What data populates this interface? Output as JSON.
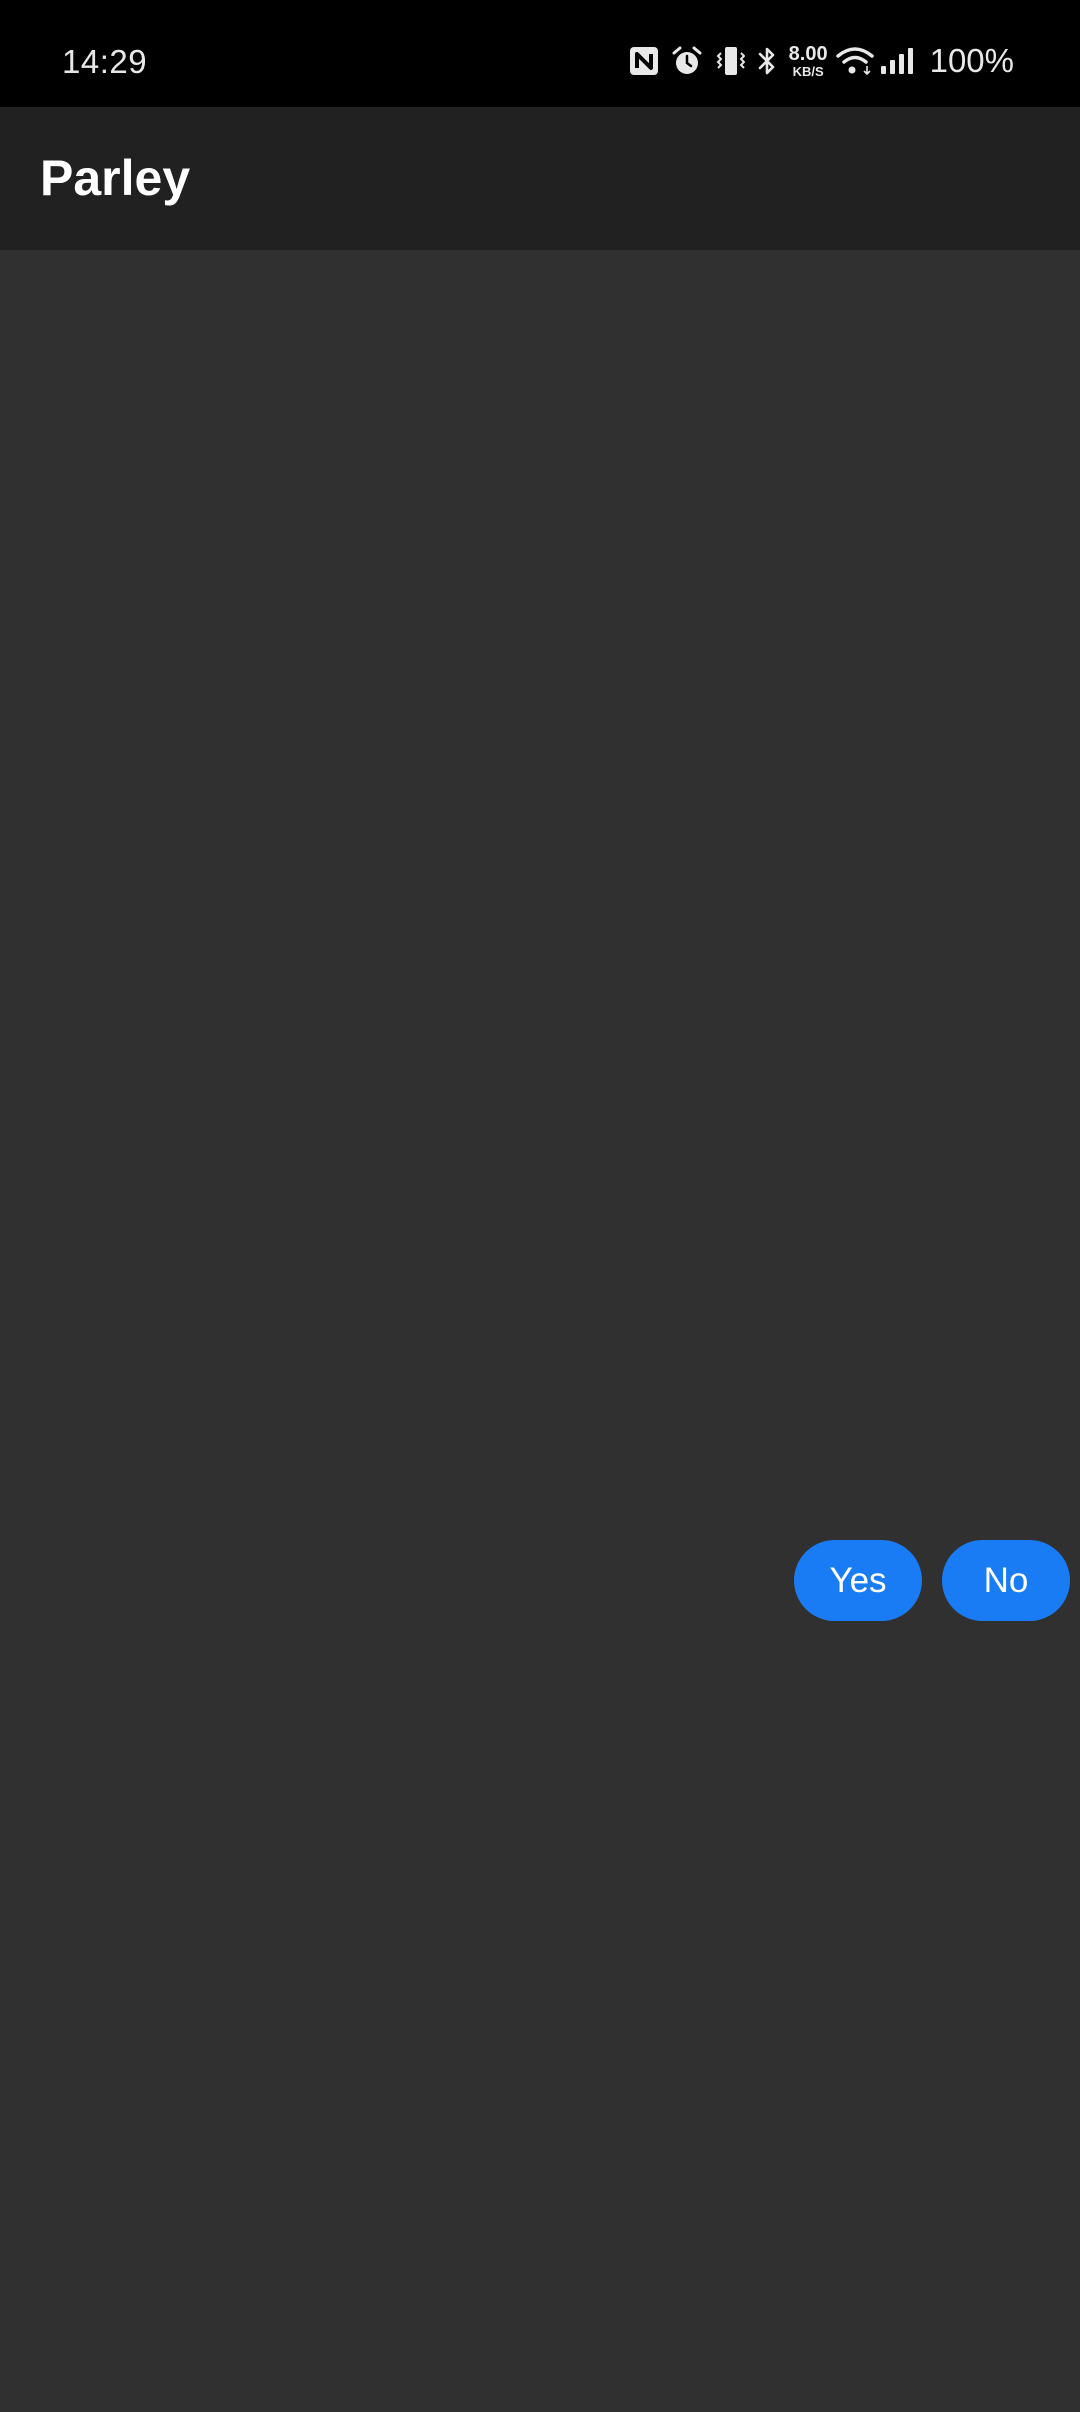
{
  "status_bar": {
    "time": "14:29",
    "net_speed_value": "8.00",
    "net_speed_unit": "KB/S",
    "battery": "100%",
    "icons": [
      "nfc-icon",
      "alarm-icon",
      "vibrate-icon",
      "bluetooth-icon",
      "wifi-icon",
      "signal-icon"
    ]
  },
  "app_bar": {
    "title": "Parley"
  },
  "actions": {
    "yes_label": "Yes",
    "no_label": "No"
  },
  "colors": {
    "status_bar_bg": "#000000",
    "app_bar_bg": "#212121",
    "content_bg": "#303030",
    "button_bg": "#1a7cf4",
    "button_text": "#ffffff"
  }
}
